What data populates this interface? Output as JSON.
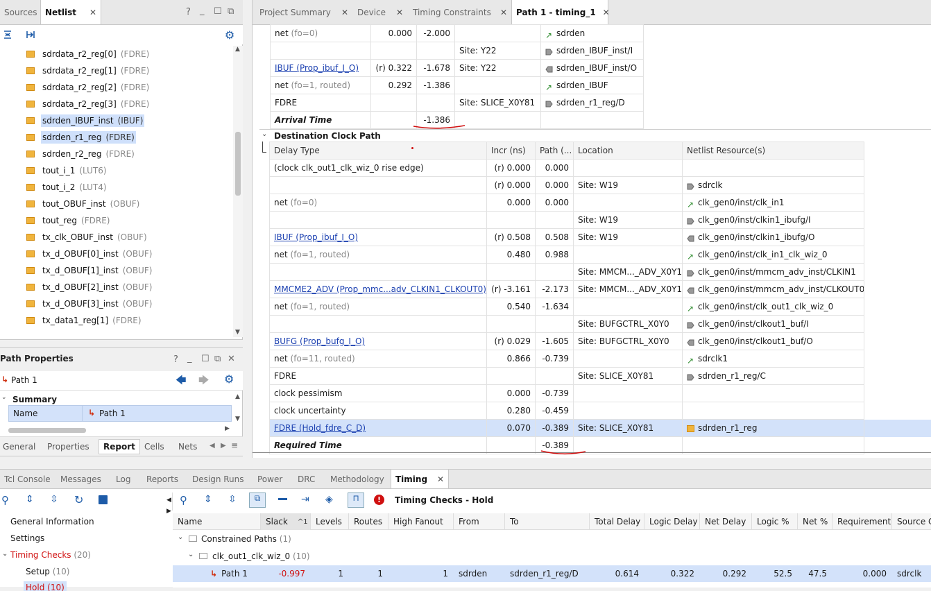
{
  "left_top": {
    "tabs": [
      "Sources",
      "Netlist"
    ],
    "items": [
      {
        "name": "sdrdata_r2_reg[0]",
        "type": "(FDRE)"
      },
      {
        "name": "sdrdata_r2_reg[1]",
        "type": "(FDRE)"
      },
      {
        "name": "sdrdata_r2_reg[2]",
        "type": "(FDRE)"
      },
      {
        "name": "sdrdata_r2_reg[3]",
        "type": "(FDRE)"
      },
      {
        "name": "sdrden_IBUF_inst",
        "type": "(IBUF)"
      },
      {
        "name": "sdrden_r1_reg",
        "type": "(FDRE)"
      },
      {
        "name": "sdrden_r2_reg",
        "type": "(FDRE)"
      },
      {
        "name": "tout_i_1",
        "type": "(LUT6)"
      },
      {
        "name": "tout_i_2",
        "type": "(LUT4)"
      },
      {
        "name": "tout_OBUF_inst",
        "type": "(OBUF)"
      },
      {
        "name": "tout_reg",
        "type": "(FDRE)"
      },
      {
        "name": "tx_clk_OBUF_inst",
        "type": "(OBUF)"
      },
      {
        "name": "tx_d_OBUF[0]_inst",
        "type": "(OBUF)"
      },
      {
        "name": "tx_d_OBUF[1]_inst",
        "type": "(OBUF)"
      },
      {
        "name": "tx_d_OBUF[2]_inst",
        "type": "(OBUF)"
      },
      {
        "name": "tx_d_OBUF[3]_inst",
        "type": "(OBUF)"
      },
      {
        "name": "tx_data1_reg[1]",
        "type": "(FDRE)"
      }
    ]
  },
  "path_props": {
    "title": "Path Properties",
    "path_name": "Path 1",
    "summary_label": "Summary",
    "name_label": "Name",
    "name_value": "Path 1",
    "tabs": [
      "General",
      "Properties",
      "Report",
      "Cells",
      "Nets"
    ]
  },
  "report_tabs": [
    "Project Summary",
    "Device",
    "Timing Constraints",
    "Path 1 - timing_1"
  ],
  "source_rows": [
    {
      "type": "net",
      "typesuffix": "(fo=0)",
      "incr": "0.000",
      "path": "-2.000",
      "loc": "",
      "res": "sdrden",
      "icon": "net"
    },
    {
      "type": "",
      "typesuffix": "",
      "incr": "",
      "path": "",
      "loc": "Site: Y22",
      "res": "sdrden_IBUF_inst/I",
      "icon": "pin-in"
    },
    {
      "type": "IBUF (Prop_ibuf_I_O)",
      "typesuffix": "",
      "incr": "(r) 0.322",
      "path": "-1.678",
      "loc": "Site: Y22",
      "res": "sdrden_IBUF_inst/O",
      "icon": "pin-out",
      "link": true
    },
    {
      "type": "net",
      "typesuffix": "(fo=1, routed)",
      "incr": "0.292",
      "path": "-1.386",
      "loc": "",
      "res": "sdrden_IBUF",
      "icon": "net"
    },
    {
      "type": "FDRE",
      "typesuffix": "",
      "incr": "",
      "path": "",
      "loc": "Site: SLICE_X0Y81",
      "res": "sdrden_r1_reg/D",
      "icon": "pin-in"
    }
  ],
  "arrival": {
    "label": "Arrival Time",
    "value": "-1.386"
  },
  "dest": {
    "section": "Destination Clock Path",
    "headers": [
      "Delay Type",
      "Incr (ns)",
      "Path (...",
      "Location",
      "Netlist Resource(s)"
    ],
    "rows": [
      {
        "type": "(clock clk_out1_clk_wiz_0 rise edge)",
        "typesuffix": "",
        "incr": "(r) 0.000",
        "path": "0.000",
        "loc": "",
        "res": "",
        "icon": ""
      },
      {
        "type": "",
        "typesuffix": "",
        "incr": "(r) 0.000",
        "path": "0.000",
        "loc": "Site: W19",
        "res": "sdrclk",
        "icon": "pin-in"
      },
      {
        "type": "net",
        "typesuffix": "(fo=0)",
        "incr": "0.000",
        "path": "0.000",
        "loc": "",
        "res": "clk_gen0/inst/clk_in1",
        "icon": "net"
      },
      {
        "type": "",
        "typesuffix": "",
        "incr": "",
        "path": "",
        "loc": "Site: W19",
        "res": "clk_gen0/inst/clkin1_ibufg/I",
        "icon": "pin-in"
      },
      {
        "type": "IBUF (Prop_ibuf_I_O)",
        "typesuffix": "",
        "incr": "(r) 0.508",
        "path": "0.508",
        "loc": "Site: W19",
        "res": "clk_gen0/inst/clkin1_ibufg/O",
        "icon": "pin-out",
        "link": true
      },
      {
        "type": "net",
        "typesuffix": "(fo=1, routed)",
        "incr": "0.480",
        "path": "0.988",
        "loc": "",
        "res": "clk_gen0/inst/clk_in1_clk_wiz_0",
        "icon": "net"
      },
      {
        "type": "",
        "typesuffix": "",
        "incr": "",
        "path": "",
        "loc": "Site: MMCM..._ADV_X0Y1",
        "res": "clk_gen0/inst/mmcm_adv_inst/CLKIN1",
        "icon": "pin-in"
      },
      {
        "type": "MMCME2_ADV (Prop_mmc...adv_CLKIN1_CLKOUT0)",
        "typesuffix": "",
        "incr": "(r) -3.161",
        "path": "-2.173",
        "loc": "Site: MMCM..._ADV_X0Y1",
        "res": "clk_gen0/inst/mmcm_adv_inst/CLKOUT0",
        "icon": "pin-out",
        "link": true
      },
      {
        "type": "net",
        "typesuffix": "(fo=1, routed)",
        "incr": "0.540",
        "path": "-1.634",
        "loc": "",
        "res": "clk_gen0/inst/clk_out1_clk_wiz_0",
        "icon": "net"
      },
      {
        "type": "",
        "typesuffix": "",
        "incr": "",
        "path": "",
        "loc": "Site: BUFGCTRL_X0Y0",
        "res": "clk_gen0/inst/clkout1_buf/I",
        "icon": "pin-in"
      },
      {
        "type": "BUFG (Prop_bufg_I_O)",
        "typesuffix": "",
        "incr": "(r) 0.029",
        "path": "-1.605",
        "loc": "Site: BUFGCTRL_X0Y0",
        "res": "clk_gen0/inst/clkout1_buf/O",
        "icon": "pin-out",
        "link": true
      },
      {
        "type": "net",
        "typesuffix": "(fo=11, routed)",
        "incr": "0.866",
        "path": "-0.739",
        "loc": "",
        "res": "sdrclk1",
        "icon": "net"
      },
      {
        "type": "FDRE",
        "typesuffix": "",
        "incr": "",
        "path": "",
        "loc": "Site: SLICE_X0Y81",
        "res": "sdrden_r1_reg/C",
        "icon": "pin-in"
      },
      {
        "type": "clock pessimism",
        "typesuffix": "",
        "incr": "0.000",
        "path": "-0.739",
        "loc": "",
        "res": "",
        "icon": ""
      },
      {
        "type": "clock uncertainty",
        "typesuffix": "",
        "incr": "0.280",
        "path": "-0.459",
        "loc": "",
        "res": "",
        "icon": ""
      },
      {
        "type": "FDRE (Hold_fdre_C_D)",
        "typesuffix": "",
        "incr": "0.070",
        "path": "-0.389",
        "loc": "Site: SLICE_X0Y81",
        "res": "sdrden_r1_reg",
        "icon": "cell",
        "link": true,
        "selected": true
      }
    ],
    "required": {
      "label": "Required Time",
      "value": "-0.389"
    }
  },
  "bottom": {
    "tabs": [
      "Tcl Console",
      "Messages",
      "Log",
      "Reports",
      "Design Runs",
      "Power",
      "DRC",
      "Methodology",
      "Timing"
    ],
    "title": "Timing Checks - Hold",
    "tree": {
      "general": "General Information",
      "settings": "Settings",
      "checks": "Timing Checks",
      "checks_count": "(20)",
      "setup": "Setup",
      "setup_count": "(10)",
      "hold": "Hold",
      "hold_count": "(10)"
    },
    "columns": [
      "Name",
      "Slack",
      "Levels",
      "Routes",
      "High Fanout",
      "From",
      "To",
      "Total Delay",
      "Logic Delay",
      "Net Delay",
      "Logic %",
      "Net %",
      "Requirement",
      "Source C"
    ],
    "sort_marker": "^1",
    "group1": {
      "label": "Constrained Paths",
      "count": "(1)"
    },
    "group2": {
      "label": "clk_out1_clk_wiz_0",
      "count": "(10)"
    },
    "row": {
      "name": "Path 1",
      "slack": "-0.997",
      "levels": "1",
      "routes": "1",
      "fanout": "1",
      "from": "sdrden",
      "to": "sdrden_r1_reg/D",
      "total": "0.614",
      "logic": "0.322",
      "net": "0.292",
      "logic_pct": "52.5",
      "net_pct": "47.5",
      "req": "0.000",
      "src": "sdrclk"
    }
  },
  "colors": {
    "selection": "#d3e2fa",
    "link": "#1a3fb0",
    "red": "#d01010",
    "accent": "#1f5fcf"
  }
}
